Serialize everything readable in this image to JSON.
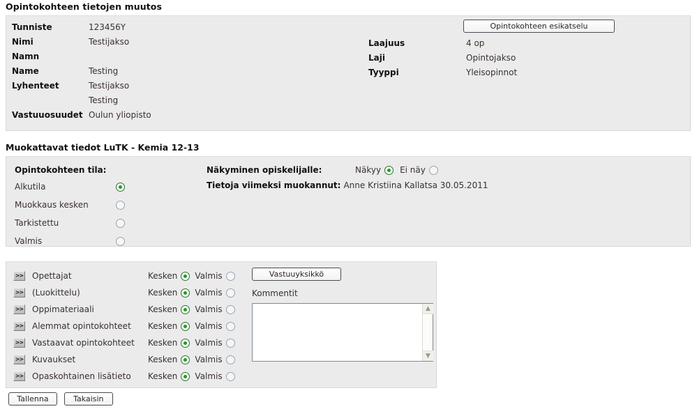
{
  "page": {
    "title": "Opintokohteen tietojen muutos"
  },
  "info": {
    "left_rows": [
      {
        "label": "Tunniste",
        "value": "123456Y"
      },
      {
        "label": "Nimi",
        "value": "Testijakso"
      },
      {
        "label": "Namn",
        "value": ""
      },
      {
        "label": "Name",
        "value": "Testing"
      },
      {
        "label": "Lyhenteet",
        "value": "Testijakso"
      },
      {
        "label": "",
        "value": "Testing"
      },
      {
        "label": "Vastuuosuudet",
        "value": "Oulun yliopisto"
      }
    ],
    "right_rows": [
      {
        "label": "Laajuus",
        "value": "4 op"
      },
      {
        "label": "Laji",
        "value": "Opintojakso"
      },
      {
        "label": "Tyyppi",
        "value": "Yleisopinnot"
      }
    ],
    "preview_button": "Opintokohteen esikatselu"
  },
  "edit": {
    "heading": "Muokattavat tiedot LuTK - Kemia 12-13",
    "status_title": "Opintokohteen tila:",
    "status_options": [
      {
        "label": "Alkutila",
        "selected": true
      },
      {
        "label": "Muokkaus kesken",
        "selected": false
      },
      {
        "label": "Tarkistettu",
        "selected": false
      },
      {
        "label": "Valmis",
        "selected": false
      }
    ],
    "visibility_label": "Näkyminen opiskelijalle:",
    "visibility_options": [
      {
        "label": "Näkyy",
        "selected": true
      },
      {
        "label": "Ei näy",
        "selected": false
      }
    ],
    "modified_label": "Tietoja viimeksi muokannut:",
    "modified_value": "Anne Kristiina Kallatsa 30.05.2011"
  },
  "sections": {
    "arrow_glyph": ">>",
    "option_in_progress": "Kesken",
    "option_done": "Valmis",
    "rows": [
      {
        "name": "Opettajat",
        "in_progress": true,
        "done": false
      },
      {
        "name": "(Luokittelu)",
        "in_progress": true,
        "done": false
      },
      {
        "name": "Oppimateriaali",
        "in_progress": true,
        "done": false
      },
      {
        "name": "Alemmat opintokohteet",
        "in_progress": true,
        "done": false
      },
      {
        "name": "Vastaavat opintokohteet",
        "in_progress": true,
        "done": false
      },
      {
        "name": "Kuvaukset",
        "in_progress": true,
        "done": false
      },
      {
        "name": "Opaskohtainen lisätieto",
        "in_progress": true,
        "done": false
      }
    ],
    "unit_button": "Vastuuyksikkö",
    "comments_label": "Kommentit",
    "comments_value": "",
    "comments_placeholder": ""
  },
  "footer": {
    "save_label": "Tallenna",
    "back_label": "Takaisin"
  },
  "colors": {
    "panel_bg": "#ebebeb",
    "panel_border": "#d6d6d6",
    "label_text": "#111111",
    "value_text": "#3b3030",
    "radio_selected": "#1f9b28",
    "radio_ring": "#2f7030"
  }
}
